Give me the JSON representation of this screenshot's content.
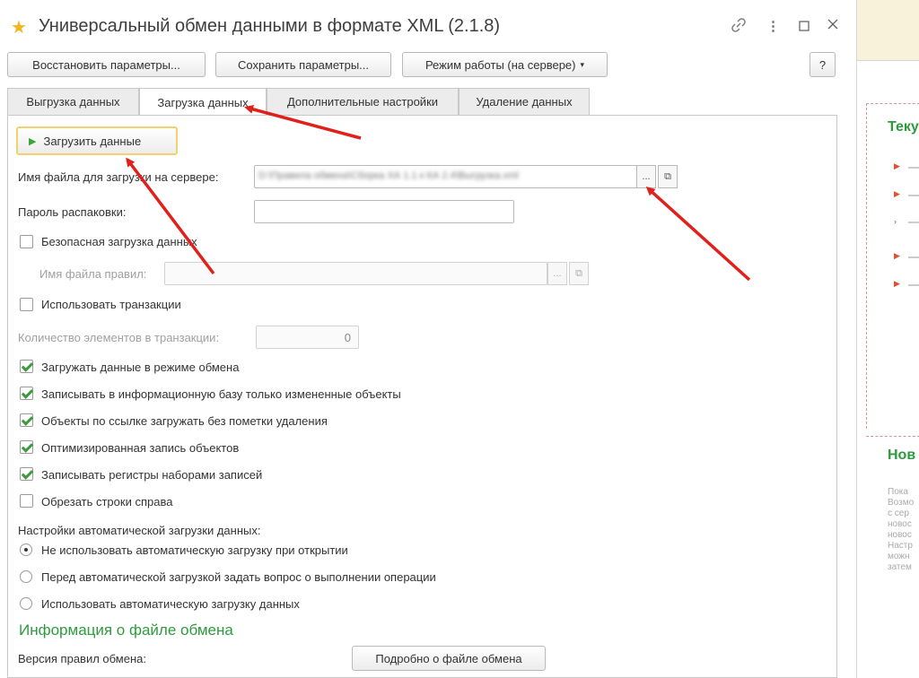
{
  "window": {
    "title": "Универсальный обмен данными в формате XML (2.1.8)",
    "icons": [
      "star-icon",
      "link-icon",
      "more-icon",
      "maximize-icon",
      "close-icon"
    ]
  },
  "toolbar": {
    "restore_label": "Восстановить параметры...",
    "save_label": "Сохранить параметры...",
    "mode_label": "Режим работы (на сервере)",
    "help_label": "?"
  },
  "tabs": [
    {
      "label": "Выгрузка данных"
    },
    {
      "label": "Загрузка данных"
    },
    {
      "label": "Дополнительные настройки"
    },
    {
      "label": "Удаление данных"
    }
  ],
  "load": {
    "load_button": "Загрузить данные",
    "file_label": "Имя файла для загрузки на сервере:",
    "file_value": "D:\\Правила обмена\\Сборка ХА 1.1 к КА 2.4\\Выгрузка.xml",
    "password_label": "Пароль распаковки:",
    "password_value": "",
    "safe_load_label": "Безопасная загрузка данных",
    "rules_file_label": "Имя файла правил:",
    "use_transactions_label": "Использовать транзакции",
    "tx_count_label": "Количество элементов в транзакции:",
    "tx_count_value": "0"
  },
  "options": [
    {
      "label": "Загружать данные в режиме обмена",
      "checked": true
    },
    {
      "label": "Записывать в информационную базу только измененные объекты",
      "checked": true
    },
    {
      "label": "Объекты по ссылке загружать без пометки удаления",
      "checked": true
    },
    {
      "label": "Оптимизированная запись объектов",
      "checked": true
    },
    {
      "label": "Записывать регистры наборами записей",
      "checked": true
    },
    {
      "label": "Обрезать строки справа",
      "checked": false
    }
  ],
  "auto_load": {
    "heading": "Настройки автоматической загрузки данных:",
    "choices": [
      {
        "label": "Не использовать автоматическую загрузку при открытии",
        "selected": true
      },
      {
        "label": "Перед автоматической загрузкой задать вопрос о выполнении операции",
        "selected": false
      },
      {
        "label": "Использовать автоматическую загрузку данных",
        "selected": false
      }
    ]
  },
  "file_info": {
    "heading": "Информация о файле обмена",
    "rules_version_label": "Версия правил обмена:",
    "details_button": "Подробно о файле обмена"
  },
  "right_panel": {
    "title_current": "Теку",
    "title_news": "Нов",
    "news_lines": [
      "Пока",
      "Возмо",
      "с сер",
      "новос",
      "новос",
      "Настр",
      "можн",
      "затем"
    ]
  },
  "colors": {
    "accent_green": "#2e9a3e",
    "star_yellow": "#f3b61f",
    "arrow_red": "#e0201b"
  }
}
